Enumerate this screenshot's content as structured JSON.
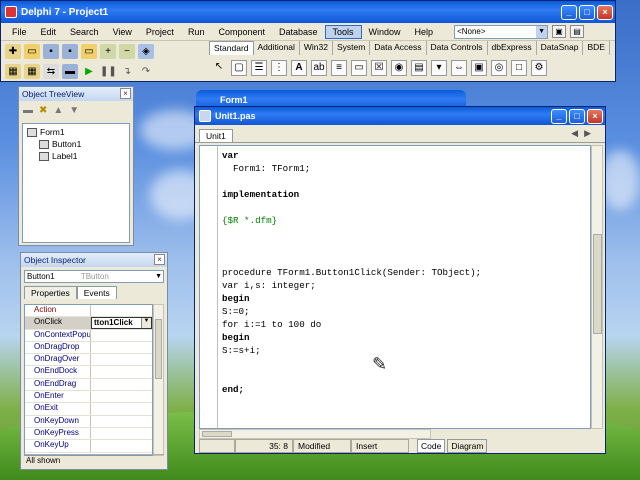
{
  "ide": {
    "title": "Delphi 7 - Project1",
    "window_controls": {
      "minimize": "_",
      "maximize": "□",
      "close": "×"
    },
    "menu": [
      "File",
      "Edit",
      "Search",
      "View",
      "Project",
      "Run",
      "Component",
      "Database",
      "Tools",
      "Window",
      "Help"
    ],
    "active_menu": "Tools",
    "config_combo": "<None>",
    "palette_tabs": [
      "Standard",
      "Additional",
      "Win32",
      "System",
      "Data Access",
      "Data Controls",
      "dbExpress",
      "DataSnap",
      "BDE"
    ],
    "active_palette_tab": "Standard"
  },
  "tree_view": {
    "title": "Object TreeView",
    "nodes": [
      {
        "label": "Form1"
      },
      {
        "label": "Button1"
      },
      {
        "label": "Label1"
      }
    ]
  },
  "inspector": {
    "title": "Object Inspector",
    "selected_object": "Button1",
    "selected_type": "TButton",
    "tabs": [
      "Properties",
      "Events"
    ],
    "active_tab": "Events",
    "rows": [
      {
        "key": "Action",
        "value": ""
      },
      {
        "key": "OnClick",
        "value": "tton1Click"
      },
      {
        "key": "OnContextPopu",
        "value": ""
      },
      {
        "key": "OnDragDrop",
        "value": ""
      },
      {
        "key": "OnDragOver",
        "value": ""
      },
      {
        "key": "OnEndDock",
        "value": ""
      },
      {
        "key": "OnEndDrag",
        "value": ""
      },
      {
        "key": "OnEnter",
        "value": ""
      },
      {
        "key": "OnExit",
        "value": ""
      },
      {
        "key": "OnKeyDown",
        "value": ""
      },
      {
        "key": "OnKeyPress",
        "value": ""
      },
      {
        "key": "OnKeyUp",
        "value": ""
      }
    ],
    "status": "All shown"
  },
  "form_window": {
    "title": "Form1"
  },
  "editor": {
    "title": "Unit1.pas",
    "tab": "Unit1",
    "lines": [
      "var",
      "  Form1: TForm1;",
      "",
      "implementation",
      "",
      "{$R *.dfm}",
      "",
      "",
      "",
      "procedure TForm1.Button1Click(Sender: TObject);",
      "var i,s: integer;",
      "begin",
      "S:=0;",
      "for i:=1 to 100 do",
      "begin",
      "S:=s+i;",
      "",
      "",
      "end;"
    ],
    "status": {
      "position": "35:  8",
      "modified": "Modified",
      "mode": "Insert"
    },
    "bottom_tabs": [
      "Code",
      "Diagram"
    ]
  }
}
